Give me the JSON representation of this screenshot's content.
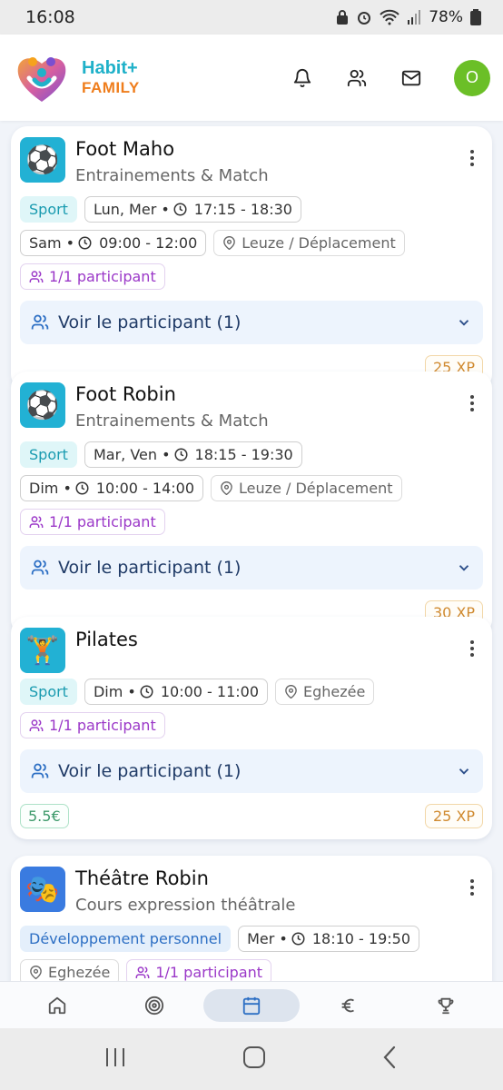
{
  "status_bar": {
    "time": "16:08",
    "battery": "78%"
  },
  "header": {
    "brand_line1": "Habit+",
    "brand_line2": "FAMILY",
    "avatar_initial": "O"
  },
  "cards": [
    {
      "emoji": "⚽",
      "title": "Foot Maho",
      "subtitle": "Entrainements & Match",
      "category": "Sport",
      "schedules": [
        "Lun, Mer • ",
        "17:15 - 18:30",
        "Sam • ",
        "09:00 - 12:00"
      ],
      "location": "Leuze / Déplacement",
      "participants_tag": "1/1 participant",
      "participants_toggle": "Voir le participant (1)",
      "xp": "25 XP"
    },
    {
      "emoji": "⚽",
      "title": "Foot Robin",
      "subtitle": "Entrainements & Match",
      "category": "Sport",
      "schedules": [
        "Mar, Ven • ",
        "18:15 - 19:30",
        "Dim • ",
        "10:00 - 14:00"
      ],
      "location": "Leuze / Déplacement",
      "participants_tag": "1/1 participant",
      "participants_toggle": "Voir le participant (1)",
      "xp": "30 XP"
    },
    {
      "emoji": "🏋",
      "title": "Pilates",
      "category": "Sport",
      "schedules": [
        "Dim • ",
        "10:00 - 11:00"
      ],
      "location": "Eghezée",
      "participants_tag": "1/1 participant",
      "participants_toggle": "Voir le participant (1)",
      "money": "5.5€",
      "xp": "25 XP"
    },
    {
      "emoji": "🎭",
      "title": "Théâtre Robin",
      "subtitle": "Cours expression théâtrale",
      "category": "Développement personnel",
      "schedules": [
        "Mer • ",
        "18:10 - 19:50"
      ],
      "location": "Eghezée",
      "participants_tag": "1/1 participant"
    }
  ],
  "colors": {
    "brand_teal": "#1fb1c9",
    "brand_orange": "#ef7d1c",
    "avatar": "#6bbf27",
    "sport_tag": "#1a9bb0",
    "participant_tag": "#9b38c8",
    "xp_badge": "#d08a30",
    "money_badge": "#3e9a6b"
  },
  "bottom_nav": {
    "items": [
      "home-icon",
      "target-icon",
      "calendar-icon",
      "euro-icon",
      "trophy-icon"
    ],
    "active": "calendar-icon"
  }
}
